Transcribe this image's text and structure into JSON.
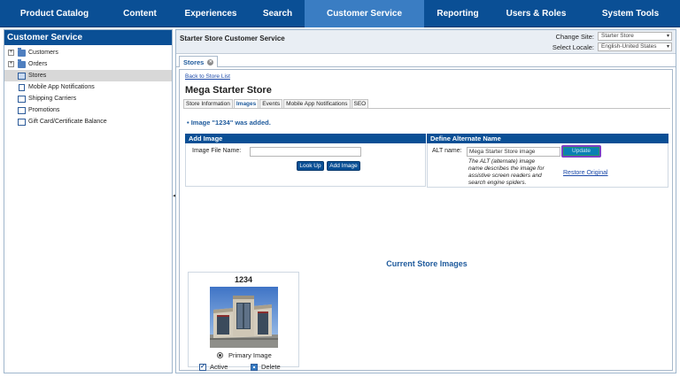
{
  "nav": {
    "items": [
      {
        "label": "Product Catalog",
        "active": false
      },
      {
        "label": "Content",
        "active": false
      },
      {
        "label": "Experiences",
        "active": false
      },
      {
        "label": "Search",
        "active": false
      },
      {
        "label": "Customer Service",
        "active": true
      },
      {
        "label": "Reporting",
        "active": false
      },
      {
        "label": "Users & Roles",
        "active": false
      },
      {
        "label": "System Tools",
        "active": false
      }
    ]
  },
  "sidebar": {
    "title": "Customer Service",
    "items": [
      {
        "label": "Customers",
        "icon": "folder-icon",
        "expandable": true
      },
      {
        "label": "Orders",
        "icon": "folder-icon",
        "expandable": true
      },
      {
        "label": "Stores",
        "icon": "store-icon",
        "selected": true
      },
      {
        "label": "Mobile App Notifications",
        "icon": "phone-icon"
      },
      {
        "label": "Shipping Carriers",
        "icon": "page-icon"
      },
      {
        "label": "Promotions",
        "icon": "page-icon"
      },
      {
        "label": "Gift Card/Certificate Balance",
        "icon": "page-icon"
      }
    ]
  },
  "header": {
    "title": "Starter Store Customer Service",
    "change_site_label": "Change Site:",
    "change_site_value": "Starter Store",
    "locale_label": "Select Locale:",
    "locale_value": "English-United States"
  },
  "tab": {
    "label": "Stores"
  },
  "store": {
    "back_link": "Back to Store List",
    "name": "Mega Starter Store",
    "subtabs": [
      {
        "label": "Store Information",
        "active": false
      },
      {
        "label": "Images",
        "active": true
      },
      {
        "label": "Events",
        "active": false
      },
      {
        "label": "Mobile App Notifications",
        "active": false
      },
      {
        "label": "SEO",
        "active": false
      }
    ],
    "message": "• Image \"1234\" was added."
  },
  "add_image": {
    "heading": "Add Image",
    "file_label": "Image File Name:",
    "file_value": "",
    "lookup_label": "Look Up",
    "add_label": "Add Image"
  },
  "alt_name": {
    "heading": "Define Alternate Name",
    "label": "ALT name:",
    "value": "Mega Starter Store image",
    "update_label": "Update",
    "help_lines": [
      "The ALT (alternate) image",
      "name describes the image for",
      "assistive screen readers and",
      "search engine spiders."
    ],
    "restore_label": "Restore Original"
  },
  "current_images": {
    "title": "Current Store Images",
    "card": {
      "title": "1234",
      "primary_label": "Primary Image",
      "active_label": "Active",
      "delete_label": "Delete"
    }
  },
  "colors": {
    "brand": "#0a4f95",
    "nav_active": "#3a7dc3",
    "link": "#1a48a8",
    "highlight": "#7b3fc4"
  }
}
